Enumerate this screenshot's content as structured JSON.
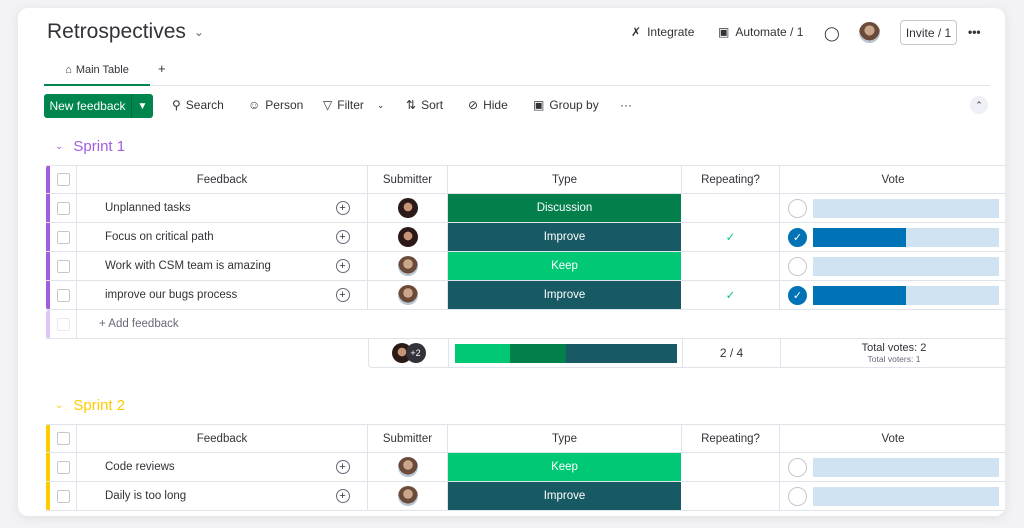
{
  "header": {
    "title": "Retrospectives",
    "integrate": "Integrate",
    "automate": "Automate / 1",
    "invite": "Invite / 1",
    "more": "•••"
  },
  "tabs": [
    {
      "label": "Main Table"
    }
  ],
  "add_tab": "+",
  "toolbar": {
    "new_item": "New feedback",
    "search": "Search",
    "person": "Person",
    "filter": "Filter",
    "sort": "Sort",
    "hide": "Hide",
    "group_by": "Group by",
    "more": "···"
  },
  "columns": [
    "Feedback",
    "Submitter",
    "Type",
    "Repeating?",
    "Vote"
  ],
  "colors": {
    "Discussion": "#037f4c",
    "Improve": "#175a63",
    "Keep": "#00c875",
    "sprint1": "#a25ddc",
    "sprint2": "#ffcb00",
    "vote": "#0073b6"
  },
  "groups": [
    {
      "title": "Sprint 1",
      "items": [
        {
          "feedback": "Unplanned tasks",
          "type": "Discussion",
          "repeating": false,
          "voted": false,
          "vote": 0
        },
        {
          "feedback": "Focus on critical path",
          "type": "Improve",
          "repeating": true,
          "voted": true,
          "vote": 0.5
        },
        {
          "feedback": "Work with CSM team is amazing",
          "type": "Keep",
          "repeating": false,
          "voted": false,
          "vote": 0
        },
        {
          "feedback": "improve our bugs process",
          "type": "Improve",
          "repeating": true,
          "voted": true,
          "vote": 0.5
        }
      ],
      "add_label": "+ Add feedback",
      "summary": {
        "submitters_extra": "+2",
        "repeating": "2 / 4",
        "total_votes": "Total votes: 2",
        "total_voters": "Total voters: 1",
        "type_dist": [
          {
            "type": "Keep",
            "share": 0.25
          },
          {
            "type": "Discussion",
            "share": 0.25
          },
          {
            "type": "Improve",
            "share": 0.5
          }
        ]
      }
    },
    {
      "title": "Sprint 2",
      "items": [
        {
          "feedback": "Code reviews",
          "type": "Keep",
          "repeating": false,
          "voted": false,
          "vote": 0
        },
        {
          "feedback": "Daily is too long",
          "type": "Improve",
          "repeating": false,
          "voted": false,
          "vote": 0
        }
      ]
    }
  ]
}
